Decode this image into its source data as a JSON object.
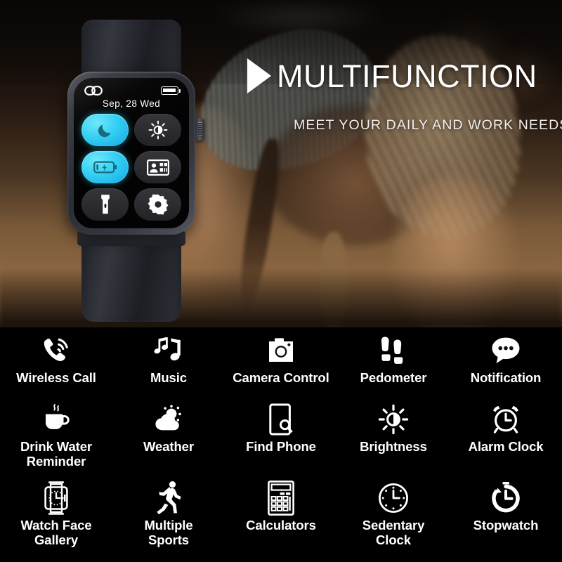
{
  "hero": {
    "headline": "MULTIFUNCTION",
    "subheadline": "MEET YOUR DAILY AND WORK NEEDS",
    "play_marker_icon": "play-triangle-icon",
    "background_description": "woman doing push-up in dim gym",
    "text_color": "#FFFFFF"
  },
  "watch": {
    "status": {
      "link_icon": "chain-link-icon",
      "battery_icon": "battery-full-icon"
    },
    "date": "Sep,  28   Wed",
    "tiles": [
      {
        "name": "do-not-disturb",
        "icon": "moon-icon",
        "active": true
      },
      {
        "name": "brightness",
        "icon": "sun-half-icon",
        "active": false
      },
      {
        "name": "battery-saver",
        "icon": "battery-bolt-icon",
        "active": true
      },
      {
        "name": "contacts",
        "icon": "contact-card-icon",
        "active": false
      },
      {
        "name": "flashlight",
        "icon": "flashlight-icon",
        "active": false
      },
      {
        "name": "settings",
        "icon": "gear-icon",
        "active": false
      }
    ],
    "active_tile_color": "#31CDF2",
    "case_color": "#3B3D45",
    "strap_color": "#26272E"
  },
  "features": {
    "background_color": "#000000",
    "rows": [
      [
        {
          "label": "Wireless Call",
          "icon": "phone-waves-icon"
        },
        {
          "label": "Music",
          "icon": "music-notes-icon"
        },
        {
          "label": "Camera Control",
          "icon": "camera-icon"
        },
        {
          "label": "Pedometer",
          "icon": "footprints-icon"
        },
        {
          "label": "Notification",
          "icon": "chat-bubble-icon"
        }
      ],
      [
        {
          "label": "Drink Water\nReminder",
          "icon": "coffee-cup-icon"
        },
        {
          "label": "Weather",
          "icon": "sun-cloud-icon"
        },
        {
          "label": "Find Phone",
          "icon": "phone-search-icon"
        },
        {
          "label": "Brightness",
          "icon": "sun-half-icon"
        },
        {
          "label": "Alarm Clock",
          "icon": "alarm-clock-icon"
        }
      ],
      [
        {
          "label": "Watch Face\nGallery",
          "icon": "watch-face-icon"
        },
        {
          "label": "Multiple\nSports",
          "icon": "runner-icon"
        },
        {
          "label": "Calculators",
          "icon": "calculator-icon"
        },
        {
          "label": "Sedentary\nClock",
          "icon": "clock-icon"
        },
        {
          "label": "Stopwatch",
          "icon": "stopwatch-icon"
        }
      ]
    ]
  }
}
